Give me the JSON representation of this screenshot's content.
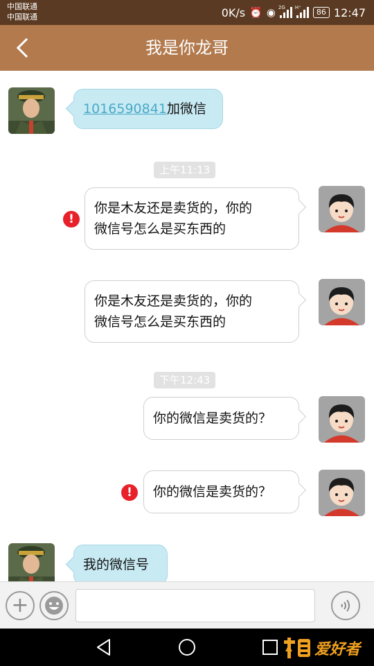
{
  "status_bar": {
    "carrier_1": "中国联通",
    "carrier_2": "中国联通",
    "speed": "0K/s",
    "network": "2G",
    "network_2": "H⁺",
    "battery": "86",
    "time": "12:47"
  },
  "header": {
    "title": "我是你龙哥"
  },
  "messages": [
    {
      "side": "incoming",
      "link": "1016590841",
      "text": "加微信"
    },
    {
      "type": "timestamp",
      "text": "上午11:13"
    },
    {
      "side": "outgoing",
      "failed": true,
      "line1": "你是木友还是卖货的，你的",
      "line2": "微信号怎么是买东西的"
    },
    {
      "side": "outgoing",
      "failed": false,
      "line1": "你是木友还是卖货的，你的",
      "line2": "微信号怎么是买东西的"
    },
    {
      "type": "timestamp",
      "text": "下午12:43"
    },
    {
      "side": "outgoing",
      "failed": false,
      "text": "你的微信是卖货的？"
    },
    {
      "side": "outgoing",
      "failed": true,
      "text": "你的微信是卖货的？"
    },
    {
      "side": "incoming",
      "text": "我的微信号"
    }
  ],
  "input_bar": {
    "placeholder": "",
    "plus_icon": "plus-icon",
    "emoji_icon": "smiley-icon",
    "voice_icon": "voice-icon"
  },
  "nav_bar": {
    "back_icon": "triangle-back-icon",
    "home_icon": "circle-home-icon",
    "recent_icon": "square-recent-icon"
  },
  "watermark": {
    "text": "爱好者"
  },
  "colors": {
    "status_bar": "#5a3a22",
    "header": "#b27a4d",
    "incoming_bubble": "#c8eaf3",
    "outgoing_bubble": "#ffffff",
    "error": "#e8202a",
    "link": "#4aa9c8"
  }
}
